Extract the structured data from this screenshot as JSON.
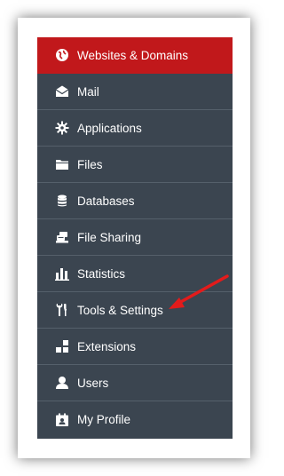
{
  "menu": {
    "items": [
      {
        "label": "Websites & Domains",
        "icon": "globe-icon",
        "active": true
      },
      {
        "label": "Mail",
        "icon": "mail-icon"
      },
      {
        "label": "Applications",
        "icon": "gear-icon"
      },
      {
        "label": "Files",
        "icon": "folder-icon"
      },
      {
        "label": "Databases",
        "icon": "database-icon"
      },
      {
        "label": "File Sharing",
        "icon": "file-sharing-icon"
      },
      {
        "label": "Statistics",
        "icon": "bar-chart-icon"
      },
      {
        "label": "Tools & Settings",
        "icon": "tools-icon"
      },
      {
        "label": "Extensions",
        "icon": "extensions-icon"
      },
      {
        "label": "Users",
        "icon": "user-icon"
      },
      {
        "label": "My Profile",
        "icon": "profile-icon"
      }
    ]
  },
  "colors": {
    "menu_bg": "#3b4550",
    "active_bg": "#c1181b",
    "arrow": "#e31b1b"
  }
}
